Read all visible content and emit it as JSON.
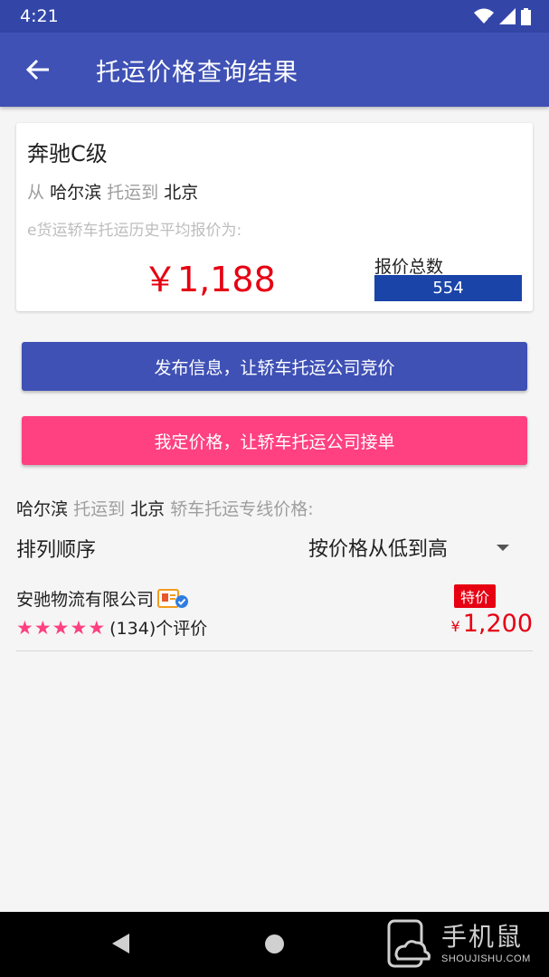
{
  "status_bar": {
    "time": "4:21"
  },
  "app_bar": {
    "title": "托运价格查询结果"
  },
  "summary": {
    "car_name": "奔驰C级",
    "from_prefix": "从",
    "origin": "哈尔滨",
    "to_word": "托运到",
    "destination": "北京",
    "history_label": "e货运轿车托运历史平均报价为:",
    "avg_price": "￥1,188",
    "quote_total_label": "报价总数",
    "quote_total": "554"
  },
  "buttons": {
    "publish": "发布信息，让轿车托运公司竞价",
    "fixed_price": "我定价格，让轿车托运公司接单"
  },
  "line_section": {
    "origin": "哈尔滨",
    "to_word": "托运到",
    "destination": "北京",
    "suffix": "轿车托运专线价格:"
  },
  "sort": {
    "label": "排列顺序",
    "value": "按价格从低到高"
  },
  "companies": [
    {
      "name": "安驰物流有限公司",
      "rating_stars": 5,
      "review_count": "(134)个评价",
      "badge": "特价",
      "currency": "¥",
      "price": "1,200"
    }
  ],
  "watermark": {
    "title": "手机鼠",
    "subtitle": "SHOUJISHU.COM"
  },
  "colors": {
    "primary": "#3f51b5",
    "primary_dark": "#3346a8",
    "accent": "#ff4081",
    "price_red": "#e60012",
    "quote_bar": "#1a44a8"
  }
}
